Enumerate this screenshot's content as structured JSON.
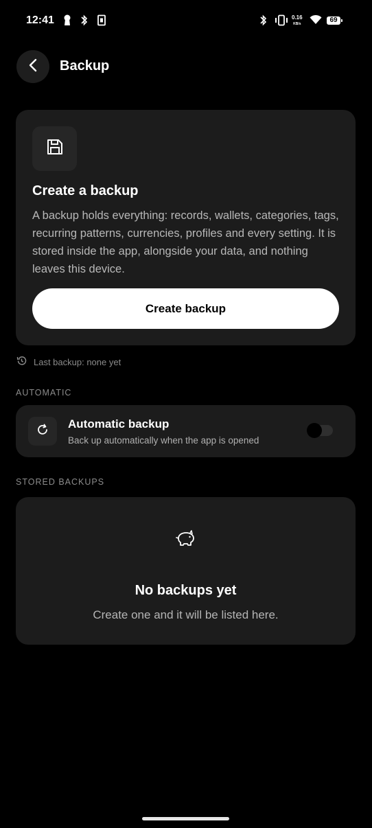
{
  "status_bar": {
    "time": "12:41",
    "net_speed": "0.16",
    "net_unit": "KB/s",
    "battery": "69",
    "icons": [
      "keyhole-icon",
      "bluetooth-icon",
      "sim-icon",
      "bluetooth-icon",
      "vibrate-icon",
      "wifi-icon",
      "battery-icon"
    ]
  },
  "header": {
    "title": "Backup",
    "back_icon": "chevron-left-icon"
  },
  "create_card": {
    "icon": "save-icon",
    "title": "Create a backup",
    "description": "A backup holds everything: records, wallets, categories, tags, recurring patterns, currencies, profiles and every setting. It is stored inside the app, alongside your data, and nothing leaves this device.",
    "button_label": "Create backup"
  },
  "last_backup": {
    "icon": "history-icon",
    "text": "Last backup: none yet"
  },
  "automatic": {
    "section_label": "AUTOMATIC",
    "icon": "refresh-icon",
    "title": "Automatic backup",
    "subtitle": "Back up automatically when the app is opened",
    "enabled": false
  },
  "stored": {
    "section_label": "STORED BACKUPS",
    "empty_icon": "piggy-bank-icon",
    "empty_title": "No backups yet",
    "empty_subtitle": "Create one and it will be listed here."
  },
  "colors": {
    "background": "#000000",
    "card": "#1c1c1c",
    "primary_button": "#ffffff",
    "muted_text": "#8c8c8c"
  }
}
